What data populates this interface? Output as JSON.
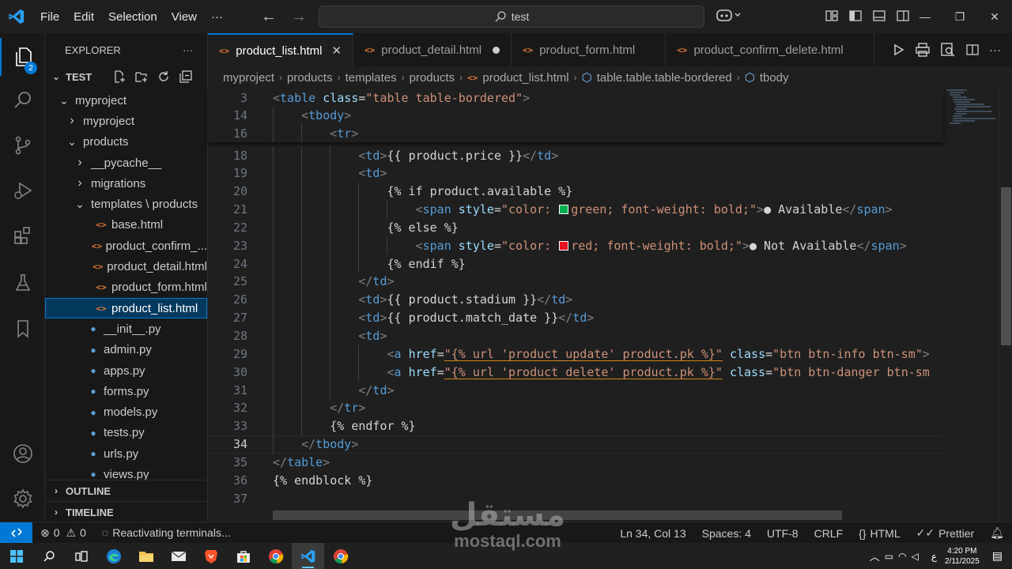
{
  "menu": {
    "file": "File",
    "edit": "Edit",
    "selection": "Selection",
    "view": "View",
    "more": "···"
  },
  "search": {
    "text": "test"
  },
  "activity": {
    "explorer_badge": "2"
  },
  "explorer": {
    "title": "EXPLORER",
    "more": "···",
    "workspace": "TEST",
    "outline": "OUTLINE",
    "timeline": "TIMELINE",
    "tree": [
      {
        "label": "myproject",
        "chev": "⌄",
        "icon": "",
        "indent": 1
      },
      {
        "label": "myproject",
        "chev": "›",
        "icon": "",
        "indent": 2
      },
      {
        "label": "products",
        "chev": "⌄",
        "icon": "",
        "indent": 2
      },
      {
        "label": "__pycache__",
        "chev": "›",
        "icon": "",
        "indent": 3
      },
      {
        "label": "migrations",
        "chev": "›",
        "icon": "",
        "indent": 3
      },
      {
        "label": "templates \\ products",
        "chev": "⌄",
        "icon": "",
        "indent": 3
      },
      {
        "label": "base.html",
        "chev": "",
        "icon": "html",
        "indent": 4
      },
      {
        "label": "product_confirm_...",
        "chev": "",
        "icon": "html",
        "indent": 4
      },
      {
        "label": "product_detail.html",
        "chev": "",
        "icon": "html",
        "indent": 4
      },
      {
        "label": "product_form.html",
        "chev": "",
        "icon": "html",
        "indent": 4
      },
      {
        "label": "product_list.html",
        "chev": "",
        "icon": "html",
        "indent": 4,
        "selected": true
      },
      {
        "label": "__init__.py",
        "chev": "",
        "icon": "py",
        "indent": 3
      },
      {
        "label": "admin.py",
        "chev": "",
        "icon": "py",
        "indent": 3
      },
      {
        "label": "apps.py",
        "chev": "",
        "icon": "py",
        "indent": 3
      },
      {
        "label": "forms.py",
        "chev": "",
        "icon": "py",
        "indent": 3
      },
      {
        "label": "models.py",
        "chev": "",
        "icon": "py",
        "indent": 3
      },
      {
        "label": "tests.py",
        "chev": "",
        "icon": "py",
        "indent": 3
      },
      {
        "label": "urls.py",
        "chev": "",
        "icon": "py",
        "indent": 3
      },
      {
        "label": "views.py",
        "chev": "",
        "icon": "py",
        "indent": 3
      }
    ]
  },
  "tabs": [
    {
      "label": "product_list.html",
      "active": true,
      "state": "close"
    },
    {
      "label": "product_detail.html",
      "active": false,
      "state": "dirty"
    },
    {
      "label": "product_form.html",
      "active": false,
      "state": ""
    },
    {
      "label": "product_confirm_delete.html",
      "active": false,
      "state": ""
    }
  ],
  "breadcrumb": [
    "myproject",
    "products",
    "templates",
    "products",
    "product_list.html",
    "table.table.table-bordered",
    "tbody"
  ],
  "code": {
    "current_line": "34",
    "sticky": [
      {
        "n": "3",
        "indent": 0,
        "t": [
          [
            "br",
            "<"
          ],
          [
            "tag",
            "table"
          ],
          [
            "tx",
            " "
          ],
          [
            "attr",
            "class"
          ],
          [
            "tx",
            "="
          ],
          [
            "str",
            "\"table table-bordered\""
          ],
          [
            "br",
            ">"
          ]
        ]
      },
      {
        "n": "14",
        "indent": 1,
        "t": [
          [
            "br",
            "<"
          ],
          [
            "tag",
            "tbody"
          ],
          [
            "br",
            ">"
          ]
        ]
      },
      {
        "n": "16",
        "indent": 2,
        "t": [
          [
            "br",
            "<"
          ],
          [
            "tag",
            "tr"
          ],
          [
            "br",
            ">"
          ]
        ]
      }
    ],
    "lines": [
      {
        "n": "18",
        "indent": 3,
        "t": [
          [
            "br",
            "<"
          ],
          [
            "tag",
            "td"
          ],
          [
            "br",
            ">"
          ],
          [
            "tx",
            "{{ product.price }}"
          ],
          [
            "br",
            "</"
          ],
          [
            "tag",
            "td"
          ],
          [
            "br",
            ">"
          ]
        ]
      },
      {
        "n": "19",
        "indent": 3,
        "t": [
          [
            "br",
            "<"
          ],
          [
            "tag",
            "td"
          ],
          [
            "br",
            ">"
          ]
        ]
      },
      {
        "n": "20",
        "indent": 4,
        "t": [
          [
            "tx",
            "{% if product.available %}"
          ]
        ]
      },
      {
        "n": "21",
        "indent": 5,
        "t": [
          [
            "br",
            "<"
          ],
          [
            "tag",
            "span"
          ],
          [
            "tx",
            " "
          ],
          [
            "attr",
            "style"
          ],
          [
            "tx",
            "="
          ],
          [
            "str",
            "\"color: "
          ],
          [
            "sw",
            "#00b050"
          ],
          [
            "str",
            "green; font-weight: bold;\""
          ],
          [
            "br",
            ">"
          ],
          [
            "tx",
            "● Available"
          ],
          [
            "br",
            "</"
          ],
          [
            "tag",
            "span"
          ],
          [
            "br",
            ">"
          ]
        ]
      },
      {
        "n": "22",
        "indent": 4,
        "t": [
          [
            "tx",
            "{% else %}"
          ]
        ]
      },
      {
        "n": "23",
        "indent": 5,
        "t": [
          [
            "br",
            "<"
          ],
          [
            "tag",
            "span"
          ],
          [
            "tx",
            " "
          ],
          [
            "attr",
            "style"
          ],
          [
            "tx",
            "="
          ],
          [
            "str",
            "\"color: "
          ],
          [
            "sw",
            "#e81123"
          ],
          [
            "str",
            "red; font-weight: bold;\""
          ],
          [
            "br",
            ">"
          ],
          [
            "tx",
            "● Not Available"
          ],
          [
            "br",
            "</"
          ],
          [
            "tag",
            "span"
          ],
          [
            "br",
            ">"
          ]
        ]
      },
      {
        "n": "24",
        "indent": 4,
        "t": [
          [
            "tx",
            "{% endif %}"
          ]
        ]
      },
      {
        "n": "25",
        "indent": 3,
        "t": [
          [
            "br",
            "</"
          ],
          [
            "tag",
            "td"
          ],
          [
            "br",
            ">"
          ]
        ]
      },
      {
        "n": "26",
        "indent": 3,
        "t": [
          [
            "br",
            "<"
          ],
          [
            "tag",
            "td"
          ],
          [
            "br",
            ">"
          ],
          [
            "tx",
            "{{ product.stadium }}"
          ],
          [
            "br",
            "</"
          ],
          [
            "tag",
            "td"
          ],
          [
            "br",
            ">"
          ]
        ]
      },
      {
        "n": "27",
        "indent": 3,
        "t": [
          [
            "br",
            "<"
          ],
          [
            "tag",
            "td"
          ],
          [
            "br",
            ">"
          ],
          [
            "tx",
            "{{ product.match_date }}"
          ],
          [
            "br",
            "</"
          ],
          [
            "tag",
            "td"
          ],
          [
            "br",
            ">"
          ]
        ]
      },
      {
        "n": "28",
        "indent": 3,
        "t": [
          [
            "br",
            "<"
          ],
          [
            "tag",
            "td"
          ],
          [
            "br",
            ">"
          ]
        ]
      },
      {
        "n": "29",
        "indent": 4,
        "t": [
          [
            "br",
            "<"
          ],
          [
            "tag",
            "a"
          ],
          [
            "tx",
            " "
          ],
          [
            "attr",
            "href"
          ],
          [
            "tx",
            "="
          ],
          [
            "sq",
            "\"{% url 'product_update' product.pk %}\""
          ],
          [
            "tx",
            " "
          ],
          [
            "attr",
            "class"
          ],
          [
            "tx",
            "="
          ],
          [
            "str",
            "\"btn btn-info btn-sm\""
          ],
          [
            "br",
            ">"
          ]
        ]
      },
      {
        "n": "30",
        "indent": 4,
        "t": [
          [
            "br",
            "<"
          ],
          [
            "tag",
            "a"
          ],
          [
            "tx",
            " "
          ],
          [
            "attr",
            "href"
          ],
          [
            "tx",
            "="
          ],
          [
            "sq",
            "\"{% url 'product_delete' product.pk %}\""
          ],
          [
            "tx",
            " "
          ],
          [
            "attr",
            "class"
          ],
          [
            "tx",
            "="
          ],
          [
            "str",
            "\"btn btn-danger btn-sm"
          ]
        ]
      },
      {
        "n": "31",
        "indent": 3,
        "t": [
          [
            "br",
            "</"
          ],
          [
            "tag",
            "td"
          ],
          [
            "br",
            ">"
          ]
        ]
      },
      {
        "n": "32",
        "indent": 2,
        "t": [
          [
            "br",
            "</"
          ],
          [
            "tag",
            "tr"
          ],
          [
            "br",
            ">"
          ]
        ]
      },
      {
        "n": "33",
        "indent": 2,
        "t": [
          [
            "tx",
            "{% endfor %}"
          ]
        ]
      },
      {
        "n": "34",
        "indent": 1,
        "t": [
          [
            "br",
            "</"
          ],
          [
            "tag",
            "tbody"
          ],
          [
            "br",
            ">"
          ]
        ]
      },
      {
        "n": "35",
        "indent": 0,
        "t": [
          [
            "br",
            "</"
          ],
          [
            "tag",
            "table"
          ],
          [
            "br",
            ">"
          ]
        ]
      },
      {
        "n": "36",
        "indent": 0,
        "t": [
          [
            "tx",
            "{% endblock %}"
          ]
        ]
      },
      {
        "n": "37",
        "indent": 0,
        "t": []
      }
    ]
  },
  "status": {
    "errors": "0",
    "warnings": "0",
    "message": "Reactivating terminals...",
    "position": "Ln 34, Col 13",
    "spaces": "Spaces: 4",
    "encoding": "UTF-8",
    "eol": "CRLF",
    "language": "HTML",
    "prettier": "Prettier"
  },
  "taskbar": {
    "lang": "ع",
    "time": "4:20 PM",
    "date": "2/11/2025"
  },
  "watermark": {
    "arabic": "مستقل",
    "latin": "mostaql.com"
  },
  "colors": {
    "accent": "#0078d4",
    "tag": "#569cd6",
    "attr": "#9cdcfe",
    "string": "#ce9178",
    "text": "#d4d4d4"
  }
}
